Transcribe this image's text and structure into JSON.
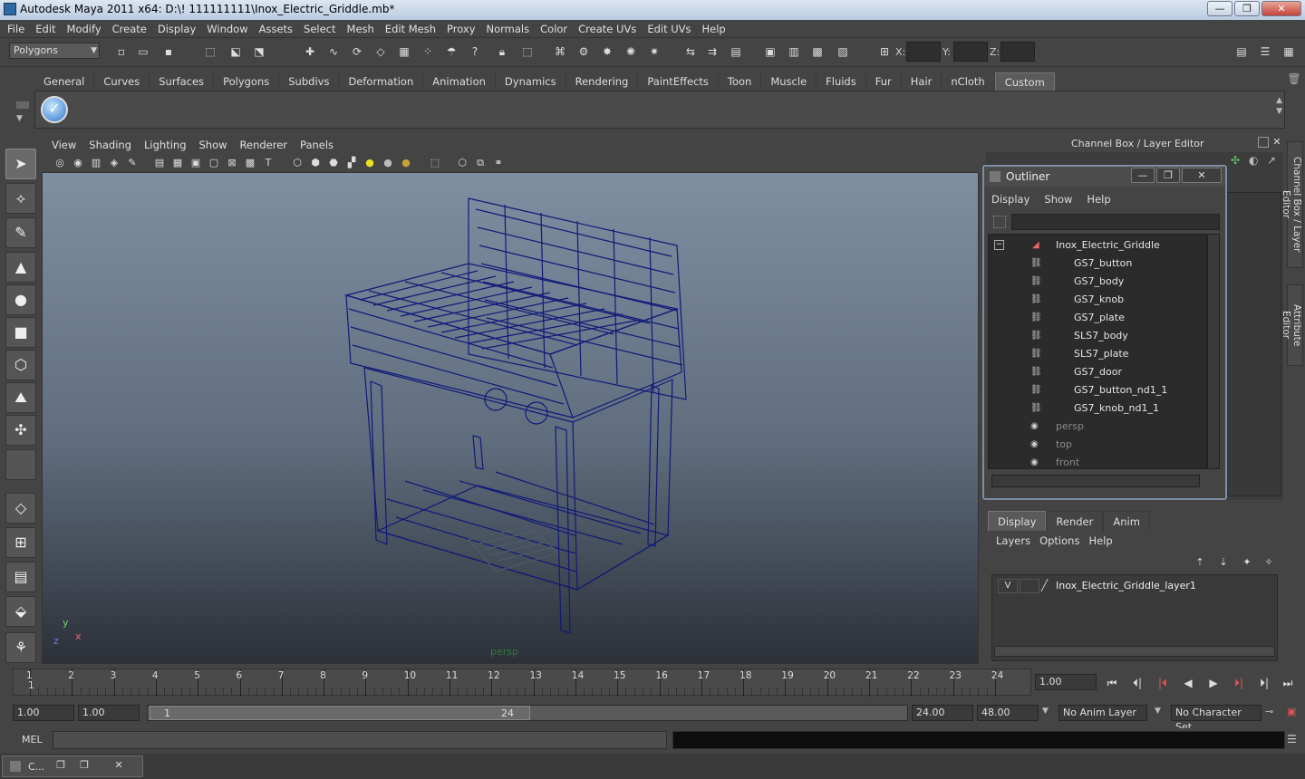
{
  "window": {
    "title": "Autodesk Maya 2011 x64: D:\\! 111111111\\Inox_Electric_Griddle.mb*",
    "minimize": "—",
    "maximize": "❐",
    "close": "✕"
  },
  "menubar": [
    "File",
    "Edit",
    "Modify",
    "Create",
    "Display",
    "Window",
    "Assets",
    "Select",
    "Mesh",
    "Edit Mesh",
    "Proxy",
    "Normals",
    "Color",
    "Create UVs",
    "Edit UVs",
    "Help"
  ],
  "status": {
    "mode": "Polygons",
    "x_label": "X:",
    "y_label": "Y:",
    "z_label": "Z:"
  },
  "shelf": {
    "tabs": [
      "General",
      "Curves",
      "Surfaces",
      "Polygons",
      "Subdivs",
      "Deformation",
      "Animation",
      "Dynamics",
      "Rendering",
      "PaintEffects",
      "Toon",
      "Muscle",
      "Fluids",
      "Fur",
      "Hair",
      "nCloth",
      "Custom"
    ],
    "active": "Custom"
  },
  "viewport": {
    "menu": [
      "View",
      "Shading",
      "Lighting",
      "Show",
      "Renderer",
      "Panels"
    ],
    "camera": "persp",
    "axis_x": "x",
    "axis_y": "y",
    "axis_z": "z"
  },
  "channel_box": {
    "title": "Channel Box / Layer Editor"
  },
  "side_tabs": [
    "Channel Box / Layer Editor",
    "Attribute Editor"
  ],
  "outliner": {
    "title": "Outliner",
    "menu": [
      "Display",
      "Show",
      "Help"
    ],
    "root": "Inox_Electric_Griddle",
    "children": [
      "GS7_button",
      "GS7_body",
      "GS7_knob",
      "GS7_plate",
      "SLS7_body",
      "SLS7_plate",
      "GS7_door",
      "GS7_button_nd1_1",
      "GS7_knob_nd1_1"
    ],
    "cameras": [
      "persp",
      "top",
      "front"
    ]
  },
  "layer_editor": {
    "tabs": [
      "Display",
      "Render",
      "Anim"
    ],
    "active": "Display",
    "menu": [
      "Layers",
      "Options",
      "Help"
    ],
    "layers": [
      {
        "visible": "V",
        "name": "Inox_Electric_Griddle_layer1"
      }
    ]
  },
  "timeline": {
    "ticks": [
      "1",
      "2",
      "3",
      "4",
      "5",
      "6",
      "7",
      "8",
      "9",
      "10",
      "11",
      "12",
      "13",
      "14",
      "15",
      "16",
      "17",
      "18",
      "19",
      "20",
      "21",
      "22",
      "23",
      "24"
    ],
    "current_frame": "1",
    "current_frame_field": "1.00"
  },
  "range": {
    "start": "1.00",
    "playback_start": "1.00",
    "slider_start": "1",
    "slider_end": "24",
    "playback_end": "24.00",
    "end": "48.00",
    "anim_layer": "No Anim Layer",
    "character_set": "No Character Set"
  },
  "command": {
    "label": "MEL"
  },
  "minimized": {
    "title": "C..."
  }
}
